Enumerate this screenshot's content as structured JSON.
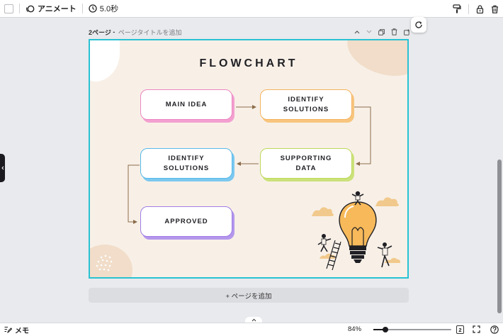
{
  "toolbar": {
    "animate_label": "アニメート",
    "duration_label": "5.0秒",
    "icons": [
      "paint-roller-icon",
      "lock-icon",
      "trash-icon"
    ]
  },
  "page": {
    "label": "2ページ",
    "separator": " - ",
    "title_placeholder": "ページタイトルを追加"
  },
  "canvas": {
    "title": "FLOWCHART",
    "boxes": [
      {
        "id": "main-idea",
        "text": "MAIN IDEA",
        "color": "#ec86c2"
      },
      {
        "id": "identify-1",
        "line1": "IDENTIFY",
        "line2": "SOLUTIONS",
        "color": "#f5b35c"
      },
      {
        "id": "supporting",
        "line1": "SUPPORTING",
        "line2": "DATA",
        "color": "#bcd85a"
      },
      {
        "id": "identify-2",
        "line1": "IDENTIFY",
        "line2": "SOLUTIONS",
        "color": "#58b9ea"
      },
      {
        "id": "approved",
        "text": "APPROVED",
        "color": "#a07ce4"
      }
    ],
    "selection_color": "#29c2d3",
    "background_color": "#f8f0e7"
  },
  "add_page_label": "+ ページを追加",
  "bottom": {
    "memo_label": "メモ",
    "zoom": "84%",
    "zoom_fraction": 0.15,
    "page_count": "2"
  }
}
